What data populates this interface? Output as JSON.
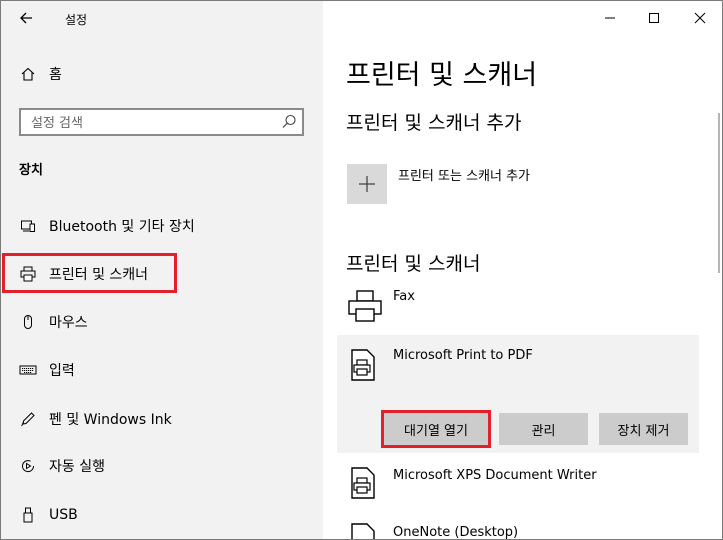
{
  "window": {
    "title": "설정"
  },
  "sidebar": {
    "home_label": "홈",
    "search_placeholder": "설정 검색",
    "section_label": "장치",
    "items": [
      {
        "label": "Bluetooth 및 기타 장치",
        "icon": "bluetooth-devices-icon"
      },
      {
        "label": "프린터 및 스캐너",
        "icon": "printer-icon",
        "selected": true
      },
      {
        "label": "마우스",
        "icon": "mouse-icon"
      },
      {
        "label": "입력",
        "icon": "keyboard-icon"
      },
      {
        "label": "펜 및 Windows Ink",
        "icon": "pen-icon"
      },
      {
        "label": "자동 실행",
        "icon": "autoplay-icon"
      },
      {
        "label": "USB",
        "icon": "usb-icon"
      }
    ]
  },
  "main": {
    "title": "프린터 및 스캐너",
    "add_section_title": "프린터 및 스캐너 추가",
    "add_button_label": "프린터 또는 스캐너 추가",
    "list_section_title": "프린터 및 스캐너",
    "printers": [
      {
        "name": "Fax"
      },
      {
        "name": "Microsoft Print to PDF",
        "selected": true
      },
      {
        "name": "Microsoft XPS Document Writer"
      },
      {
        "name": "OneNote (Desktop)"
      }
    ],
    "actions": {
      "open_queue": "대기열 열기",
      "manage": "관리",
      "remove": "장치 제거"
    }
  },
  "colors": {
    "highlight": "#e2202b",
    "sidebar_bg": "#f2f2f2",
    "button_bg": "#cccccc"
  }
}
